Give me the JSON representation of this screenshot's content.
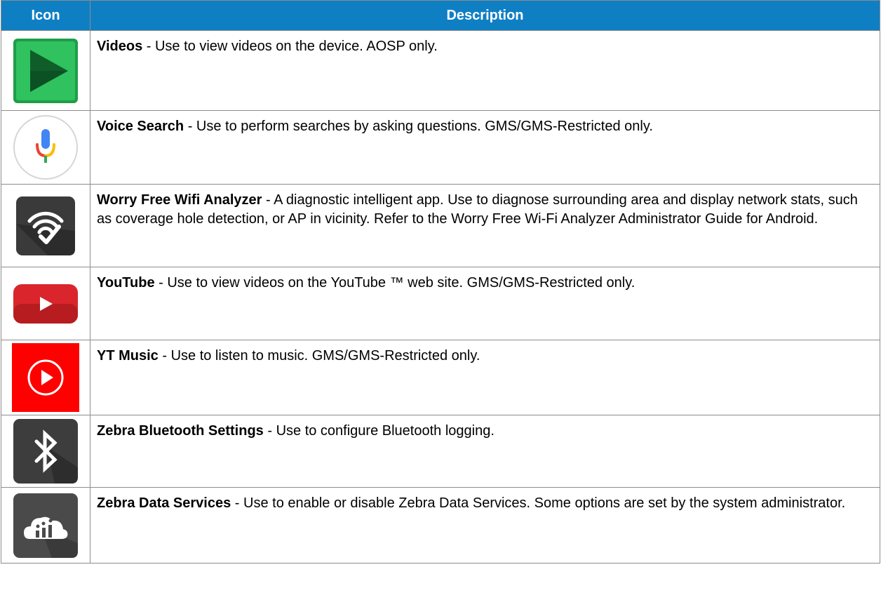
{
  "header": {
    "icon_col": "Icon",
    "description_col": "Description"
  },
  "rows": [
    {
      "icon": "videos-play-icon",
      "title": "Videos",
      "text": " - Use to view videos on the device. AOSP only."
    },
    {
      "icon": "voice-search-microphone-icon",
      "title": "Voice Search",
      "text": " - Use to perform searches by asking questions. GMS/GMS-Restricted only."
    },
    {
      "icon": "worry-free-wifi-analyzer-icon",
      "title": "Worry Free Wifi Analyzer",
      "text": " - A diagnostic intelligent app. Use to diagnose surrounding area and display network stats, such as coverage hole detection, or AP in vicinity. Refer to the Worry Free Wi-Fi Analyzer Administrator Guide for Android."
    },
    {
      "icon": "youtube-icon",
      "title": "YouTube",
      "text": " - Use to view videos on the YouTube ™ web site. GMS/GMS-Restricted only."
    },
    {
      "icon": "yt-music-icon",
      "title": "YT Music",
      "text": " - Use to listen to music. GMS/GMS-Restricted only."
    },
    {
      "icon": "zebra-bluetooth-icon",
      "title": "Zebra Bluetooth Settings",
      "text": " - Use to configure Bluetooth logging."
    },
    {
      "icon": "zebra-data-services-cloud-icon",
      "title": "Zebra Data Services",
      "text": " - Use to enable or disable Zebra Data Services. Some options are set by the system administrator."
    }
  ],
  "colors": {
    "header_bg": "#0f7fc4",
    "header_text": "#ffffff",
    "border": "#8c8c8c"
  }
}
